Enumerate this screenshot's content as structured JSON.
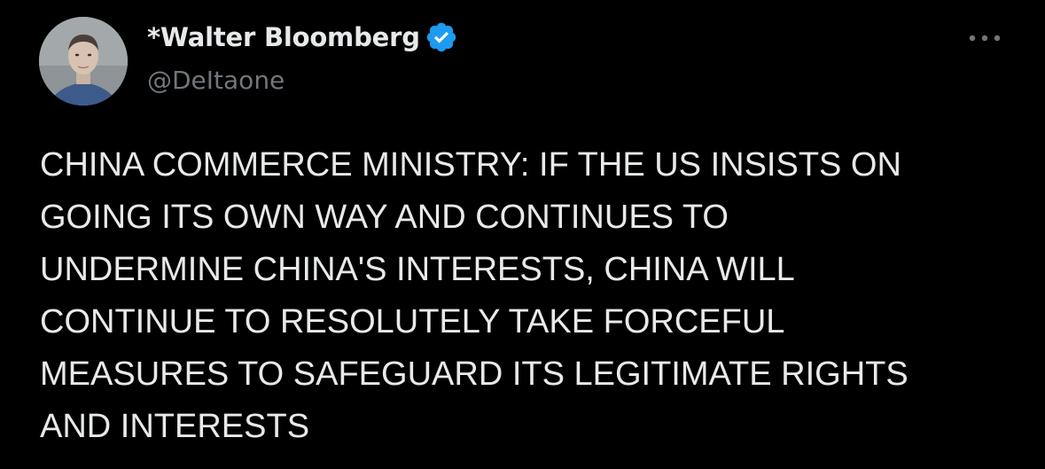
{
  "tweet": {
    "author": {
      "display_name": "*Walter Bloomberg",
      "handle": "@DeItaone",
      "verified": true,
      "avatar": "avatar-photo"
    },
    "more_icon": "more-horizontal-icon",
    "text": "CHINA COMMERCE MINISTRY: IF THE US INSISTS ON\nGOING ITS OWN WAY AND CONTINUES TO\nUNDERMINE CHINA'S INTERESTS, CHINA WILL\nCONTINUE TO RESOLUTELY TAKE FORCEFUL\nMEASURES TO SAFEGUARD ITS LEGITIMATE RIGHTS\nAND INTERESTS"
  },
  "colors": {
    "background": "#000000",
    "primary_text": "#e7e9ea",
    "secondary_text": "#71767b",
    "verified_badge": "#1d9bf0"
  }
}
